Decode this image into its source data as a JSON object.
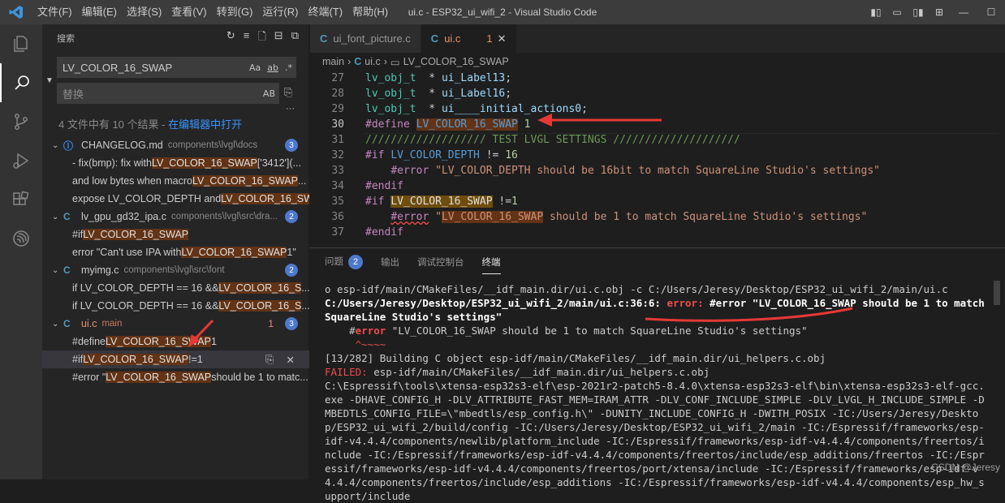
{
  "titlebar": {
    "menu": [
      "文件(F)",
      "编辑(E)",
      "选择(S)",
      "查看(V)",
      "转到(G)",
      "运行(R)",
      "终端(T)",
      "帮助(H)"
    ],
    "title": "ui.c - ESP32_ui_wifi_2 - Visual Studio Code"
  },
  "sidebar": {
    "header": "搜索",
    "search_value": "LV_COLOR_16_SWAP",
    "search_opts": [
      "Aa",
      "ab",
      ".*"
    ],
    "replace_placeholder": "替换",
    "replace_opt": "AB",
    "more": "···",
    "summary_text": "4 文件中有 10 个结果 - ",
    "summary_link": "在编辑器中打开",
    "files": [
      {
        "name": "CHANGELOG.md",
        "path": "components\\lvgl\\docs",
        "badge": "3",
        "icon": "ⓘ",
        "matches": [
          {
            "pre": "- fix(bmp): fix with ",
            "hit": "LV_COLOR_16_SWAP",
            "post": " ['3412'](..."
          },
          {
            "pre": "and low bytes when macro ",
            "hit": "LV_COLOR_16_SWAP",
            "post": " ..."
          },
          {
            "pre": "expose LV_COLOR_DEPTH and ",
            "hit": "LV_COLOR_16_SW",
            "post": "..."
          }
        ]
      },
      {
        "name": "lv_gpu_gd32_ipa.c",
        "path": "components\\lvgl\\src\\dra...",
        "badge": "2",
        "icon": "C",
        "matches": [
          {
            "pre": "#if ",
            "hit": "LV_COLOR_16_SWAP",
            "post": ""
          },
          {
            "pre": "error \"Can't use IPA with ",
            "hit": "LV_COLOR_16_SWAP",
            "post": " 1\""
          }
        ]
      },
      {
        "name": "myimg.c",
        "path": "components\\lvgl\\src\\font",
        "badge": "2",
        "icon": "C",
        "matches": [
          {
            "pre": "if LV_COLOR_DEPTH == 16 && ",
            "hit": "LV_COLOR_16_S",
            "post": "..."
          },
          {
            "pre": "if LV_COLOR_DEPTH == 16 && ",
            "hit": "LV_COLOR_16_S",
            "post": "..."
          }
        ]
      },
      {
        "name": "ui.c",
        "path": "main",
        "badge": "3",
        "errors": "1",
        "icon": "C",
        "matches": [
          {
            "pre": "#define ",
            "hit": "LV_COLOR_16_SWAP",
            "post": " 1"
          },
          {
            "pre": "#if ",
            "hit": "LV_COLOR_16_SWAP",
            "post": " !=1"
          },
          {
            "pre": "#error \"",
            "hit": "LV_COLOR_16_SWAP",
            "post": " should be 1 to matc..."
          }
        ]
      }
    ]
  },
  "editor": {
    "tabs": [
      {
        "icon": "C",
        "label": "ui_font_picture.c"
      },
      {
        "icon": "C",
        "label": "ui.c",
        "problems": "1",
        "close": "✕"
      }
    ],
    "breadcrumb": [
      "main",
      "ui.c",
      "LV_COLOR_16_SWAP"
    ],
    "lines": [
      {
        "n": "27",
        "parts": [
          [
            "ty",
            "lv_obj_t"
          ],
          [
            "",
            "  * "
          ],
          [
            "id",
            "ui_Label13"
          ],
          [
            "",
            ";"
          ]
        ]
      },
      {
        "n": "28",
        "parts": [
          [
            "ty",
            "lv_obj_t"
          ],
          [
            "",
            "  * "
          ],
          [
            "id",
            "ui_Label16"
          ],
          [
            "",
            ";"
          ]
        ]
      },
      {
        "n": "29",
        "parts": [
          [
            "ty",
            "lv_obj_t"
          ],
          [
            "",
            "  * "
          ],
          [
            "id",
            "ui____initial_actions0"
          ],
          [
            "",
            ";"
          ]
        ]
      },
      {
        "n": "30",
        "cur": true,
        "parts": [
          [
            "kw",
            "#define "
          ],
          [
            "hl",
            "LV_COLOR_16_SWAP"
          ],
          [
            "nm",
            " 1"
          ]
        ]
      },
      {
        "n": "31",
        "parts": [
          [
            "cm",
            "/////////////////// TEST LVGL SETTINGS ////////////////////"
          ]
        ]
      },
      {
        "n": "32",
        "parts": [
          [
            "kw",
            "#if "
          ],
          [
            "mac",
            "LV_COLOR_DEPTH"
          ],
          [
            "",
            " != "
          ],
          [
            "nm",
            "16"
          ]
        ]
      },
      {
        "n": "33",
        "parts": [
          [
            "",
            "    "
          ],
          [
            "kw",
            "#error "
          ],
          [
            "st",
            "\"LV_COLOR_DEPTH should be 16bit to match SquareLine Studio's settings\""
          ]
        ]
      },
      {
        "n": "34",
        "parts": [
          [
            "kw",
            "#endif"
          ]
        ]
      },
      {
        "n": "35",
        "parts": [
          [
            "kw",
            "#if "
          ],
          [
            "hlb",
            "LV_COLOR_16_SWAP"
          ],
          [
            "",
            " !="
          ],
          [
            "nm",
            "1"
          ]
        ]
      },
      {
        "n": "36",
        "parts": [
          [
            "",
            "    "
          ],
          [
            "kwwl",
            "#error"
          ],
          [
            "st",
            " \""
          ],
          [
            "hlst",
            "LV_COLOR_16_SWAP"
          ],
          [
            "st",
            " should be 1 to match SquareLine Studio's settings\""
          ]
        ]
      },
      {
        "n": "37",
        "parts": [
          [
            "kw",
            "#endif"
          ]
        ]
      }
    ]
  },
  "panel": {
    "tabs": [
      "问题",
      "输出",
      "调试控制台",
      "终端"
    ],
    "problems_badge": "2",
    "term": {
      "l1": "o esp-idf/main/CMakeFiles/__idf_main.dir/ui.c.obj -c C:/Users/Jeresy/Desktop/ESP32_ui_wifi_2/main/ui.c",
      "l2a": "C:/Users/Jeresy/Desktop/ESP32_ui_wifi_2/main/ui.c:36:6: ",
      "l2b": "error: ",
      "l2c": "#error \"LV_COLOR_16_SWAP should be 1 to match SquareLine Studio's settings\"",
      "l3a": "    #",
      "l3b": "error",
      "l3c": " \"LV_COLOR_16_SWAP should be 1 to match SquareLine Studio's settings\"",
      "l4": "     ^~~~~",
      "l5": "[13/282] Building C object esp-idf/main/CMakeFiles/__idf_main.dir/ui_helpers.c.obj",
      "l6a": "FAILED: ",
      "l6b": "esp-idf/main/CMakeFiles/__idf_main.dir/ui_helpers.c.obj",
      "l7": "C:\\Espressif\\tools\\xtensa-esp32s3-elf\\esp-2021r2-patch5-8.4.0\\xtensa-esp32s3-elf\\bin\\xtensa-esp32s3-elf-gcc.exe -DHAVE_CONFIG_H -DLV_ATTRIBUTE_FAST_MEM=IRAM_ATTR -DLV_CONF_INCLUDE_SIMPLE -DLV_LVGL_H_INCLUDE_SIMPLE -DMBEDTLS_CONFIG_FILE=\\\"mbedtls/esp_config.h\\\" -DUNITY_INCLUDE_CONFIG_H -DWITH_POSIX -IC:/Users/Jeresy/Desktop/ESP32_ui_wifi_2/build/config -IC:/Users/Jeresy/Desktop/ESP32_ui_wifi_2/main -IC:/Espressif/frameworks/esp-idf-v4.4.4/components/newlib/platform_include -IC:/Espressif/frameworks/esp-idf-v4.4.4/components/freertos/include -IC:/Espressif/frameworks/esp-idf-v4.4.4/components/freertos/include/esp_additions/freertos -IC:/Espressif/frameworks/esp-idf-v4.4.4/components/freertos/port/xtensa/include -IC:/Espressif/frameworks/esp-idf-v4.4.4/components/freertos/include/esp_additions -IC:/Espressif/frameworks/esp-idf-v4.4.4/components/esp_hw_support/include"
    },
    "watermark": "CSDN @Jeresy"
  }
}
